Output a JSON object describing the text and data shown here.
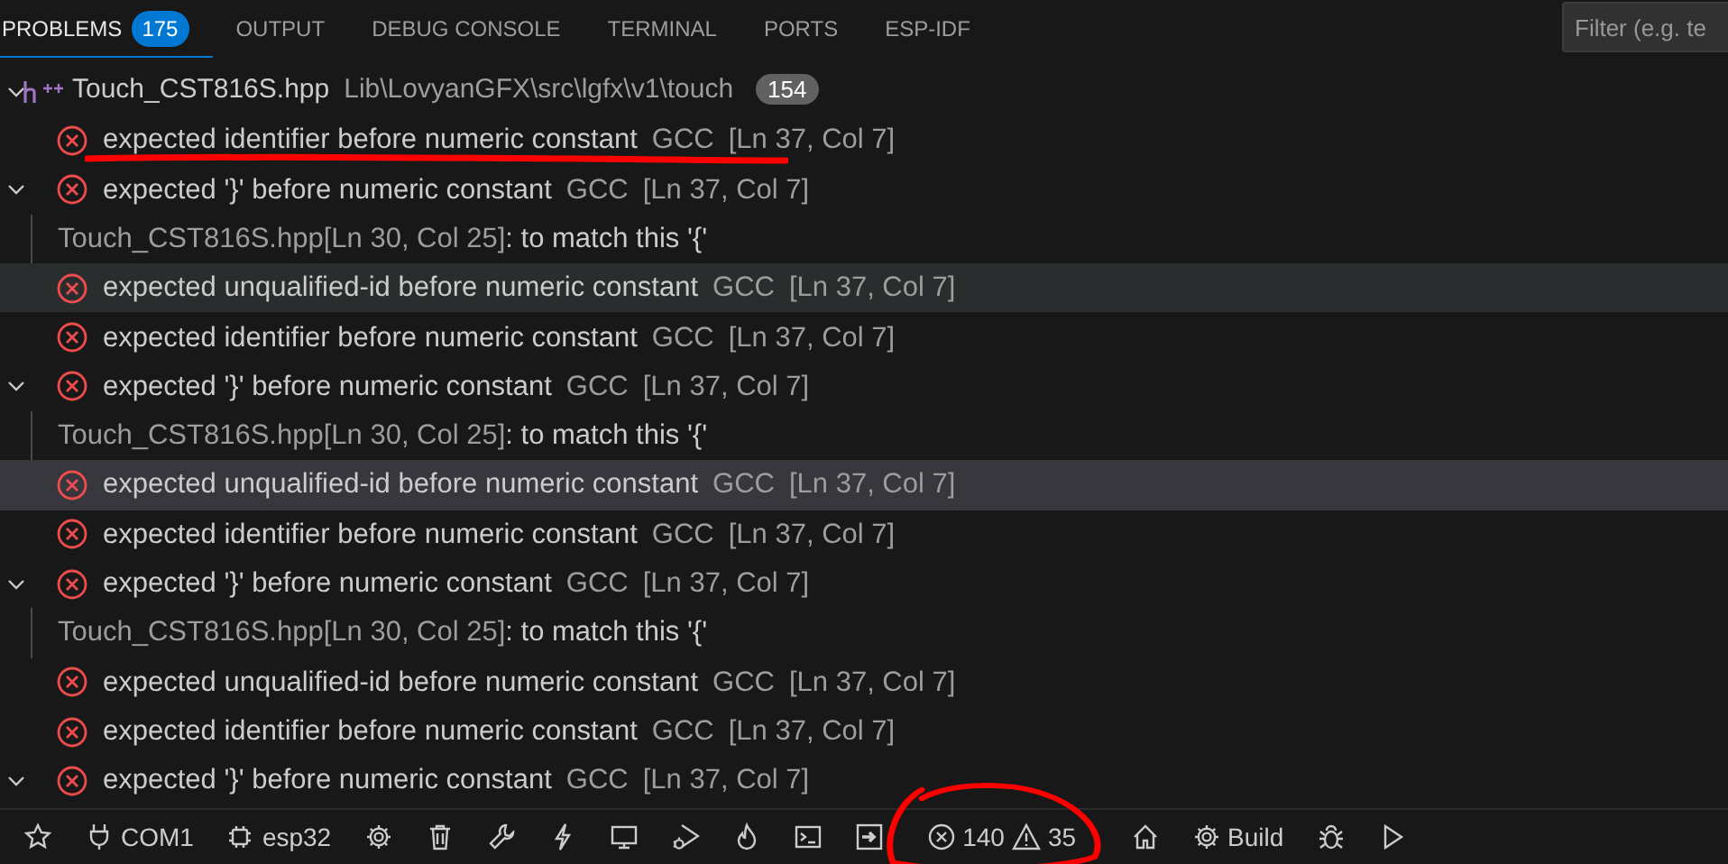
{
  "tabs": [
    {
      "label": "PROBLEMS",
      "badge": "175",
      "selected": true
    },
    {
      "label": "OUTPUT",
      "selected": false
    },
    {
      "label": "DEBUG CONSOLE",
      "selected": false
    },
    {
      "label": "TERMINAL",
      "selected": false
    },
    {
      "label": "PORTS",
      "selected": false
    },
    {
      "label": "ESP-IDF",
      "selected": false
    }
  ],
  "filter": {
    "placeholder": "Filter (e.g. te"
  },
  "file": {
    "name": "Touch_CST816S.hpp",
    "path": "Lib\\LovyanGFX\\src\\lgfx\\v1\\touch",
    "count": "154",
    "expanded": true
  },
  "problems": [
    {
      "kind": "error",
      "message": "expected identifier before numeric constant",
      "source": "GCC",
      "location": "[Ln 37, Col 7]",
      "expandable": false,
      "selected": false,
      "hovered": false,
      "underlined": true
    },
    {
      "kind": "error",
      "message": "expected '}' before numeric constant",
      "source": "GCC",
      "location": "[Ln 37, Col 7]",
      "expandable": true,
      "selected": false,
      "hovered": false
    },
    {
      "kind": "related",
      "location": "Touch_CST816S.hpp[Ln 30, Col 25]",
      "message": ": to match this '{'",
      "selected": false,
      "hovered": false
    },
    {
      "kind": "error",
      "message": "expected unqualified-id before numeric constant",
      "source": "GCC",
      "location": "[Ln 37, Col 7]",
      "expandable": false,
      "selected": false,
      "hovered": true
    },
    {
      "kind": "error",
      "message": "expected identifier before numeric constant",
      "source": "GCC",
      "location": "[Ln 37, Col 7]",
      "expandable": false,
      "selected": false,
      "hovered": false
    },
    {
      "kind": "error",
      "message": "expected '}' before numeric constant",
      "source": "GCC",
      "location": "[Ln 37, Col 7]",
      "expandable": true,
      "selected": false,
      "hovered": false
    },
    {
      "kind": "related",
      "location": "Touch_CST816S.hpp[Ln 30, Col 25]",
      "message": ": to match this '{'",
      "selected": false,
      "hovered": false
    },
    {
      "kind": "error",
      "message": "expected unqualified-id before numeric constant",
      "source": "GCC",
      "location": "[Ln 37, Col 7]",
      "expandable": false,
      "selected": true,
      "hovered": false
    },
    {
      "kind": "error",
      "message": "expected identifier before numeric constant",
      "source": "GCC",
      "location": "[Ln 37, Col 7]",
      "expandable": false,
      "selected": false,
      "hovered": false
    },
    {
      "kind": "error",
      "message": "expected '}' before numeric constant",
      "source": "GCC",
      "location": "[Ln 37, Col 7]",
      "expandable": true,
      "selected": false,
      "hovered": false
    },
    {
      "kind": "related",
      "location": "Touch_CST816S.hpp[Ln 30, Col 25]",
      "message": ": to match this '{'",
      "selected": false,
      "hovered": false
    },
    {
      "kind": "error",
      "message": "expected unqualified-id before numeric constant",
      "source": "GCC",
      "location": "[Ln 37, Col 7]",
      "expandable": false,
      "selected": false,
      "hovered": false
    },
    {
      "kind": "error",
      "message": "expected identifier before numeric constant",
      "source": "GCC",
      "location": "[Ln 37, Col 7]",
      "expandable": false,
      "selected": false,
      "hovered": false
    },
    {
      "kind": "error",
      "message": "expected '}' before numeric constant",
      "source": "GCC",
      "location": "[Ln 37, Col 7]",
      "expandable": true,
      "selected": false,
      "hovered": false
    }
  ],
  "status_bar": [
    {
      "kind": "star"
    },
    {
      "kind": "plug",
      "label": "COM1"
    },
    {
      "kind": "chip",
      "label": "esp32"
    },
    {
      "kind": "gear"
    },
    {
      "kind": "trash"
    },
    {
      "kind": "wrench"
    },
    {
      "kind": "bolt"
    },
    {
      "kind": "monitor"
    },
    {
      "kind": "debug-run"
    },
    {
      "kind": "flame"
    },
    {
      "kind": "terminal"
    },
    {
      "kind": "export"
    },
    {
      "kind": "problems",
      "errors": "140",
      "warnings": "35",
      "circled": true
    },
    {
      "kind": "home"
    },
    {
      "kind": "gear",
      "label": "Build"
    },
    {
      "kind": "bug"
    },
    {
      "kind": "play"
    }
  ]
}
